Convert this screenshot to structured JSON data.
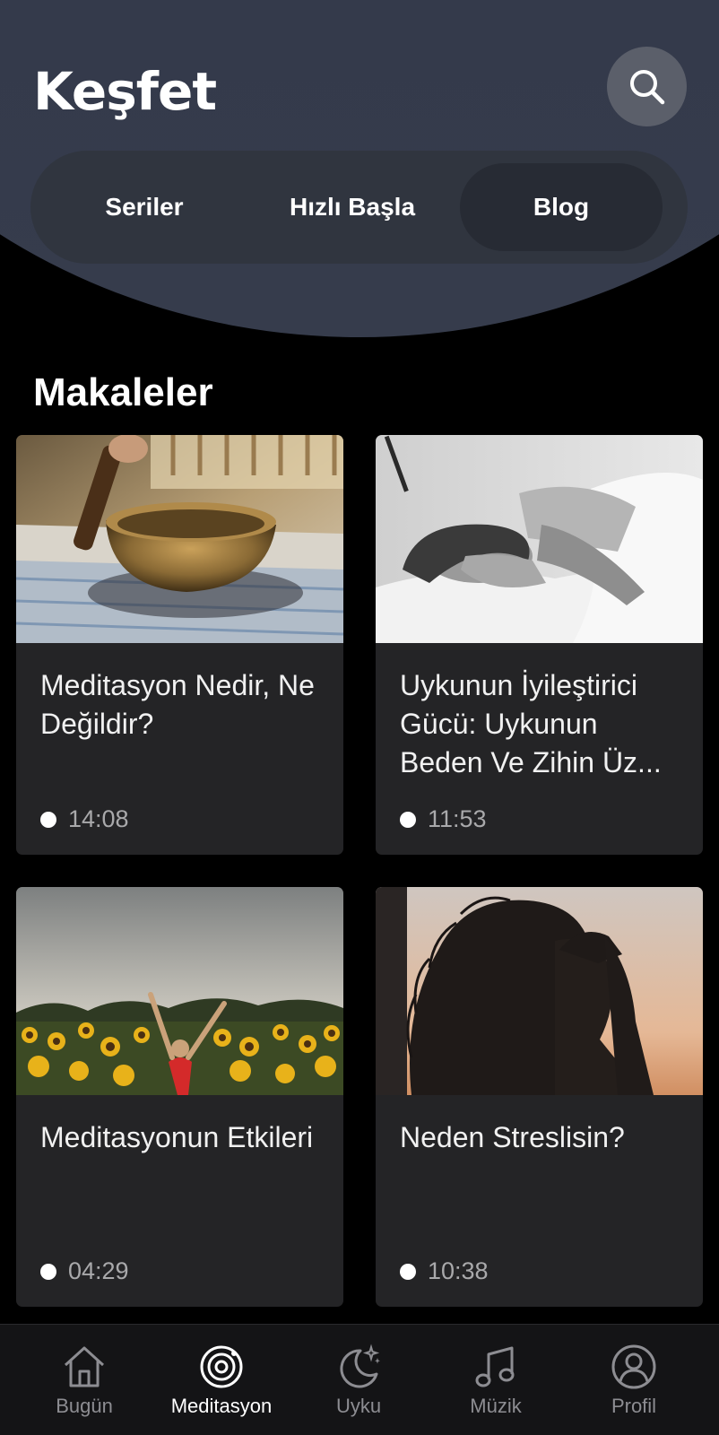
{
  "header": {
    "title": "Keşfet",
    "search_icon": "search-icon"
  },
  "tabs": [
    {
      "label": "Seriler",
      "active": false
    },
    {
      "label": "Hızlı Başla",
      "active": false
    },
    {
      "label": "Blog",
      "active": true
    }
  ],
  "section": {
    "title": "Makaleler"
  },
  "articles": [
    {
      "title": "Meditasyon Nedir, Ne Değildir?",
      "duration": "14:08",
      "image": "singing-bowl-photo"
    },
    {
      "title": "Uykunun İyileştirici Gücü: Uykunun Beden Ve Zihin Üz...",
      "duration": "11:53",
      "image": "sleeping-woman-photo"
    },
    {
      "title": "Meditasyonun Etkileri",
      "duration": "04:29",
      "image": "sunflower-field-photo"
    },
    {
      "title": "Neden Streslisin?",
      "duration": "10:38",
      "image": "stressed-woman-silhouette-photo"
    }
  ],
  "bottom_nav": [
    {
      "label": "Bugün",
      "icon": "home-icon",
      "active": false
    },
    {
      "label": "Meditasyon",
      "icon": "meditation-icon",
      "active": true
    },
    {
      "label": "Uyku",
      "icon": "moon-icon",
      "active": false
    },
    {
      "label": "Müzik",
      "icon": "music-note-icon",
      "active": false
    },
    {
      "label": "Profil",
      "icon": "profile-icon",
      "active": false
    }
  ],
  "colors": {
    "header_bg": "#343a4b",
    "card_bg": "#242426",
    "background": "#000000",
    "muted_text": "#8d8d92"
  }
}
